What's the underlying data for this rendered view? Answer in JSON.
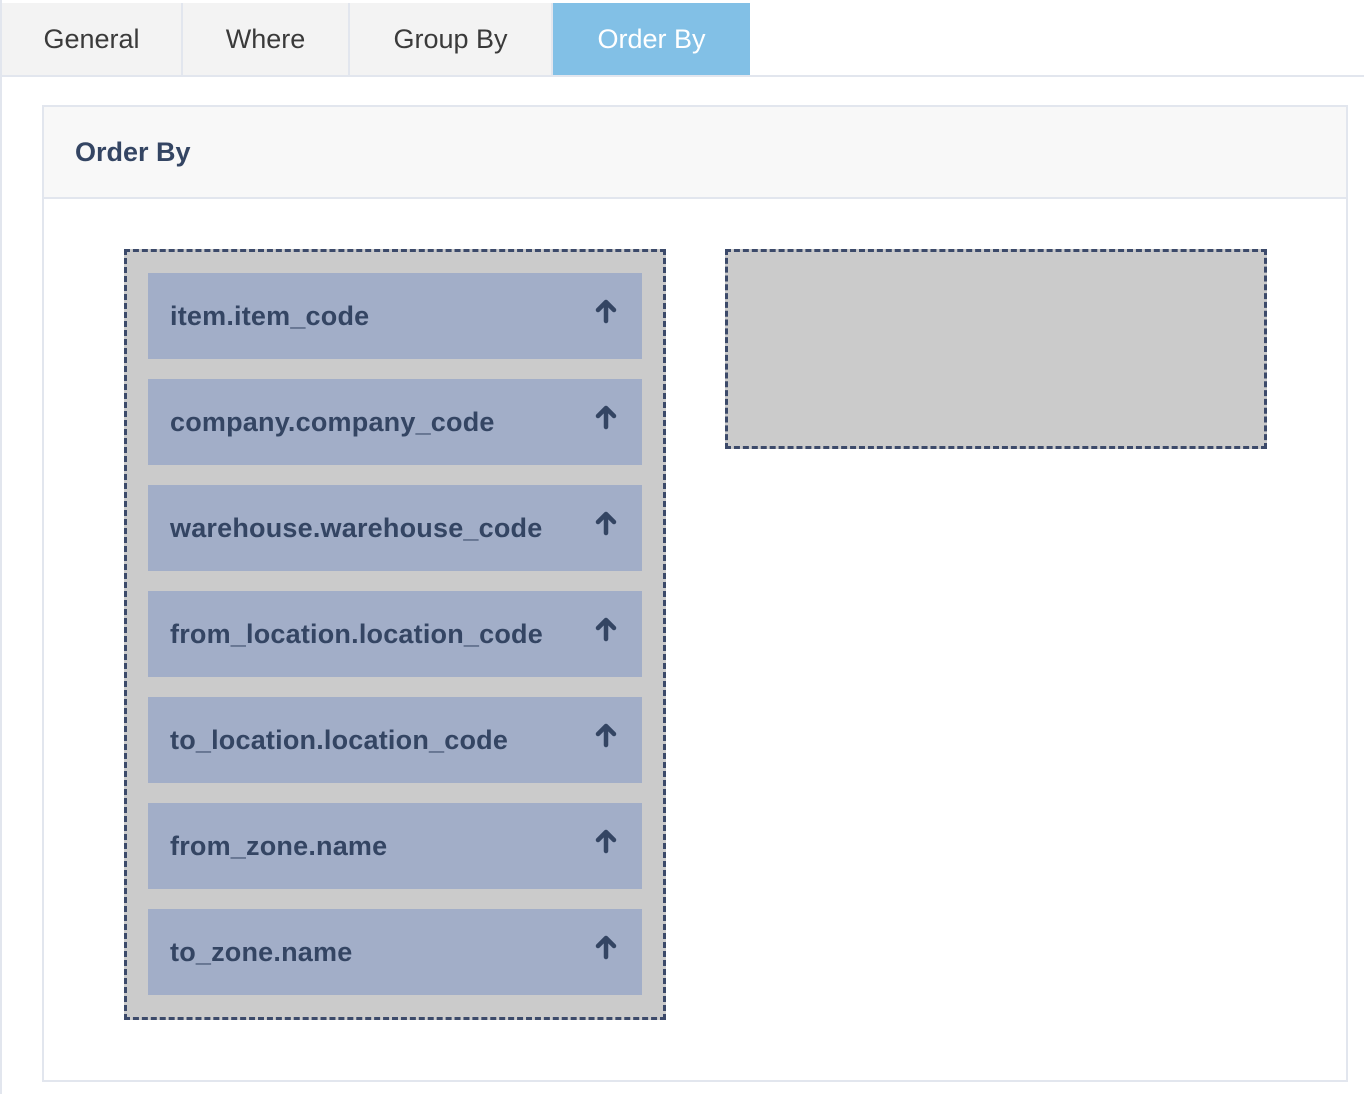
{
  "tabs": [
    {
      "label": "General",
      "active": false
    },
    {
      "label": "Where",
      "active": false
    },
    {
      "label": "Group By",
      "active": false
    },
    {
      "label": "Order By",
      "active": true
    }
  ],
  "panel": {
    "title": "Order By"
  },
  "order_by": {
    "selected_fields": [
      {
        "label": "item.item_code",
        "direction": "asc",
        "icon": "arrow-up-icon"
      },
      {
        "label": "company.company_code",
        "direction": "asc",
        "icon": "arrow-up-icon"
      },
      {
        "label": "warehouse.warehouse_code",
        "direction": "asc",
        "icon": "arrow-up-icon"
      },
      {
        "label": "from_location.location_code",
        "direction": "asc",
        "icon": "arrow-up-icon"
      },
      {
        "label": "to_location.location_code",
        "direction": "asc",
        "icon": "arrow-up-icon"
      },
      {
        "label": "from_zone.name",
        "direction": "asc",
        "icon": "arrow-up-icon"
      },
      {
        "label": "to_zone.name",
        "direction": "asc",
        "icon": "arrow-up-icon"
      }
    ],
    "available_fields": []
  },
  "colors": {
    "active_tab": "#82c0e6",
    "item_bg": "#a2aec8",
    "text_dark": "#344563",
    "dropzone_bg": "#cbcbcb",
    "dropzone_border": "#3c4a6a"
  }
}
